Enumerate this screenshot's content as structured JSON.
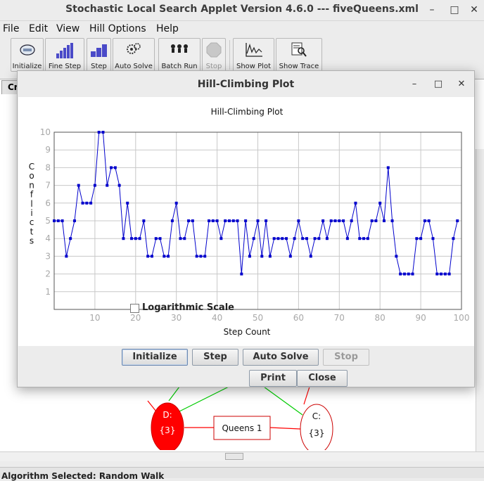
{
  "window": {
    "title": "Stochastic Local Search Applet Version 4.6.0 --- fiveQueens.xml",
    "controls": {
      "minimize": "–",
      "maximize": "□",
      "close": "✕"
    }
  },
  "menu": [
    {
      "label": "File"
    },
    {
      "label": "Edit"
    },
    {
      "label": "View"
    },
    {
      "label": "Hill Options"
    },
    {
      "label": "Help"
    }
  ],
  "toolbar": {
    "buttons": [
      {
        "label": "Initialize",
        "icon": "initialize-icon"
      },
      {
        "label": "Fine Step",
        "icon": "fine-step-icon"
      },
      {
        "label": "Step",
        "icon": "step-icon"
      },
      {
        "label": "Auto Solve",
        "icon": "auto-solve-icon"
      },
      {
        "label": "Batch Run",
        "icon": "batch-run-icon"
      },
      {
        "label": "Stop",
        "icon": "stop-icon",
        "disabled": true
      },
      {
        "label": "Show Plot",
        "icon": "show-plot-icon"
      },
      {
        "label": "Show Trace",
        "icon": "show-trace-icon"
      }
    ]
  },
  "background": {
    "tab_label": "Cr",
    "status": "Algorithm Selected: Random Walk",
    "nodes": {
      "d": {
        "name": "D:",
        "domain": "{3}",
        "color": "#ff0000"
      },
      "c": {
        "name": "C:",
        "domain": "{3}",
        "color": "#ff0000"
      },
      "constraint": {
        "label": "Queens 1"
      }
    }
  },
  "dialog": {
    "title": "Hill-Climbing Plot",
    "controls": {
      "minimize": "–",
      "maximize": "□",
      "close": "✕"
    },
    "buttons": {
      "initialize": "Initialize",
      "step": "Step",
      "auto_solve": "Auto Solve",
      "stop": "Stop",
      "print": "Print",
      "close": "Close"
    },
    "log_scale_label": "Logarithmic Scale",
    "log_scale_checked": false
  },
  "chart_data": {
    "type": "line",
    "title": "Hill-Climbing Plot",
    "xlabel": "Step Count",
    "ylabel": "Conflicts",
    "xlim": [
      0,
      100
    ],
    "ylim": [
      0,
      10
    ],
    "xticks": [
      10,
      20,
      30,
      40,
      50,
      60,
      70,
      80,
      90,
      100
    ],
    "yticks": [
      1,
      2,
      3,
      4,
      5,
      6,
      7,
      8,
      9,
      10
    ],
    "grid": true,
    "series_color": "#0000cc",
    "series": [
      {
        "values": [
          5,
          5,
          5,
          3,
          4,
          5,
          7,
          6,
          6,
          6,
          7,
          10,
          10,
          7,
          8,
          8,
          7,
          4,
          6,
          4,
          4,
          4,
          5,
          3,
          3,
          4,
          4,
          3,
          3,
          5,
          6,
          4,
          4,
          5,
          5,
          3,
          3,
          3,
          5,
          5,
          5,
          4,
          5,
          5,
          5,
          5,
          2,
          5,
          3,
          4,
          5,
          3,
          5,
          3,
          4,
          4,
          4,
          4,
          3,
          4,
          5,
          4,
          4,
          3,
          4,
          4,
          5,
          4,
          5,
          5,
          5,
          5,
          4,
          5,
          6,
          4,
          4,
          4,
          5,
          5,
          6,
          5,
          8,
          5,
          3,
          2,
          2,
          2,
          2,
          4,
          4,
          5,
          5,
          4,
          2,
          2,
          2,
          2,
          4,
          5
        ]
      }
    ]
  }
}
